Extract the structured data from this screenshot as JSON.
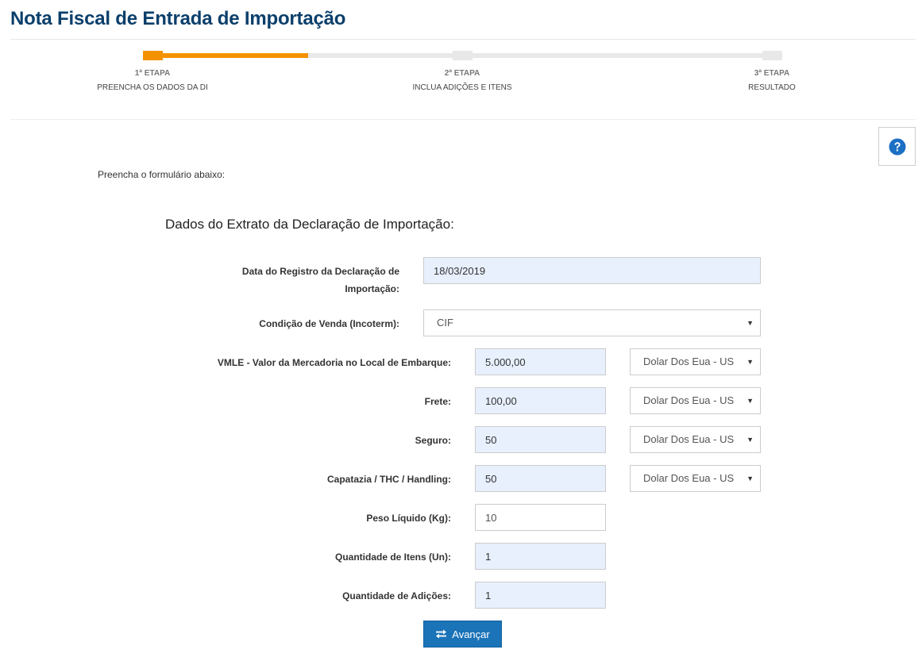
{
  "page": {
    "title": "Nota Fiscal de Entrada de Importação"
  },
  "stepper": {
    "steps": [
      {
        "number": "1ª ETAPA",
        "label": "PREENCHA OS DADOS DA DI",
        "state": "active"
      },
      {
        "number": "2ª ETAPA",
        "label": "INCLUA ADIÇÕES E ITENS",
        "state": "pending"
      },
      {
        "number": "3ª ETAPA",
        "label": "RESULTADO",
        "state": "pending"
      }
    ],
    "accent_color": "#f39200"
  },
  "help": {
    "icon": "question-circle-icon",
    "color": "#1b6fc4"
  },
  "form": {
    "intro": "Preencha o formulário abaixo:",
    "section_title": "Dados do Extrato da Declaração de Importação:",
    "fields": {
      "data_registro": {
        "label_line1": "Data do Registro da Declaração de",
        "label_line2": "Importação:",
        "value": "18/03/2019"
      },
      "condicao_venda": {
        "label": "Condição de Venda (Incoterm):",
        "value": "CIF"
      },
      "vmle": {
        "label": "VMLE - Valor da Mercadoria no Local de Embarque:",
        "value": "5.000,00",
        "currency": "Dolar Dos Eua - US"
      },
      "frete": {
        "label": "Frete:",
        "value": "100,00",
        "currency": "Dolar Dos Eua - US"
      },
      "seguro": {
        "label": "Seguro:",
        "value": "50",
        "currency": "Dolar Dos Eua - US"
      },
      "capatazia": {
        "label": "Capatazia / THC / Handling:",
        "value": "50",
        "currency": "Dolar Dos Eua - US"
      },
      "peso_liquido": {
        "label": "Peso Líquido (Kg):",
        "value": "10"
      },
      "quantidade_itens": {
        "label": "Quantidade de Itens (Un):",
        "value": "1"
      },
      "quantidade_adicoes": {
        "label": "Quantidade de Adições:",
        "value": "1"
      }
    },
    "caret_glyph": "▼",
    "submit_label": "Avançar",
    "submit_icon": "swap-arrows-icon",
    "button_color": "#1b73b8"
  }
}
